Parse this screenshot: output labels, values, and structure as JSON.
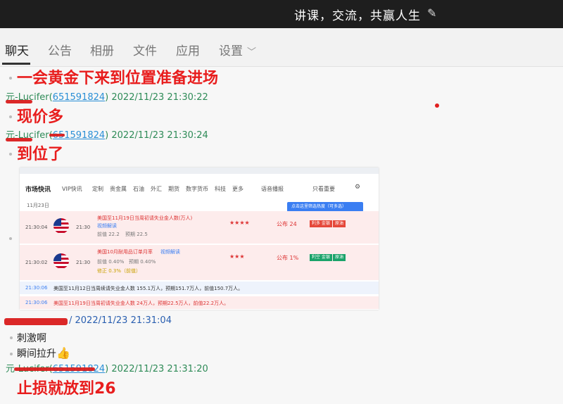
{
  "header": {
    "title": "讲课，交流，共赢人生",
    "edit_icon": "pencil-icon"
  },
  "tabs": [
    {
      "label": "聊天",
      "active": true
    },
    {
      "label": "公告"
    },
    {
      "label": "相册"
    },
    {
      "label": "文件"
    },
    {
      "label": "应用"
    },
    {
      "label": "设置"
    }
  ],
  "messages": {
    "m1": "一会黄金下来到位置准备进场",
    "meta1": {
      "name": "元-Lucifer",
      "qq": "651591824",
      "time": "2022/11/23 21:30:22"
    },
    "m2": "现价多",
    "meta2": {
      "name": "元-Lucifer",
      "qq": "651591824",
      "time": "2022/11/23 21:30:24"
    },
    "m3": "到位了",
    "meta3": {
      "time": "2022/11/23 21:31:04"
    },
    "m4": "刺激啊",
    "m5": "瞬间拉升",
    "m5_emoji": "👍",
    "meta4": {
      "name": "元-Lucifer",
      "qq": "651591824",
      "time": "2022/11/23 21:31:20"
    },
    "m6": "止损就放到26"
  },
  "screenshot": {
    "nav": [
      "市场快讯",
      "VIP快讯",
      "定制",
      "贵金属",
      "石油",
      "外汇",
      "期货",
      "数字货币",
      "科技",
      "更多"
    ],
    "voice": "语音播报",
    "important": "只看重要",
    "date": "11月23日",
    "tip": "点击这里筛选热度（可多选）",
    "items": [
      {
        "time": "21:30:04",
        "clock": "21:30",
        "headline": "美国至11月19日当周初请失业金人数(万人)",
        "video": "视频解读",
        "prev": "前值 22.2",
        "forecast": "预期 22.5",
        "stars": "★★★★",
        "pub": "公布 24",
        "tags": [
          "利多 金银",
          "原油"
        ]
      },
      {
        "time": "21:30:02",
        "clock": "21:30",
        "headline": "美国10月耐用品订单月率",
        "video": "视频解读",
        "prev": "前值 0.40%",
        "forecast": "预期 0.40%",
        "revised": "修正 0.3%（前值）",
        "stars": "★★★",
        "pub": "公布 1%",
        "tags": [
          "利空 金银",
          "原油"
        ]
      }
    ],
    "plain": [
      {
        "time": "21:30:06",
        "text": "美国至11月12日当周续请失业金人数 155.1万人，预期151.7万人，前值150.7万人。"
      },
      {
        "time": "21:30:06",
        "text": "美国至11月19日当周初请失业金人数 24万人，预期22.5万人，前值22.2万人。"
      }
    ]
  },
  "colors": {
    "accent_red": "#e81d1d",
    "meta_green": "#2e8b57",
    "link_blue": "#2a8fd6"
  }
}
